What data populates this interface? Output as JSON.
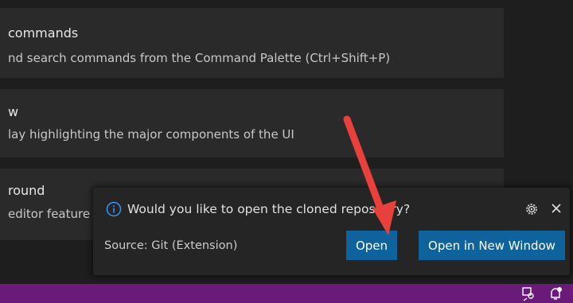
{
  "cards": [
    {
      "title": "commands",
      "desc": "nd search commands from the Command Palette (Ctrl+Shift+P)"
    },
    {
      "title": "w",
      "desc": "lay highlighting the major components of the UI"
    },
    {
      "title": "round",
      "desc": "editor feature"
    }
  ],
  "notification": {
    "message": "Would you like to open the cloned repository?",
    "source": "Source: Git (Extension)",
    "open_label": "Open",
    "open_new_window_label": "Open in New Window"
  },
  "icons": {
    "notification": "info-icon",
    "settings": "gear-icon",
    "close": "close-icon",
    "status_left": "remote-account-icon",
    "status_right": "notification-bell-icon"
  },
  "colors": {
    "accent_button": "#0e639c",
    "status_bar": "#6a1b7a",
    "annotation_arrow": "#e8403a"
  }
}
